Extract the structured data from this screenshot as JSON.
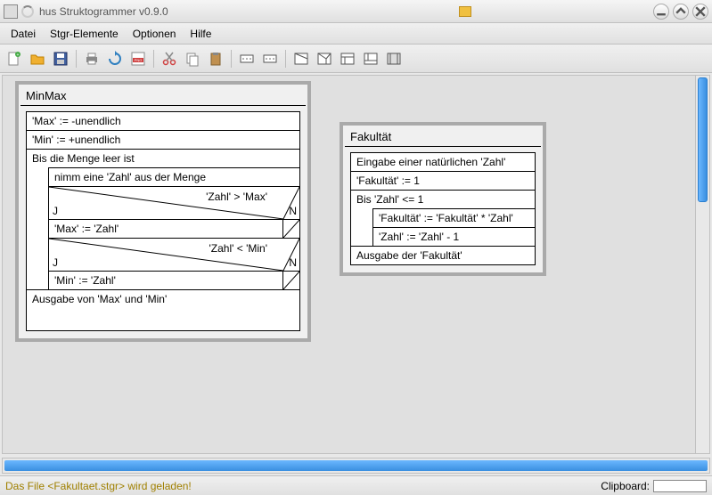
{
  "window": {
    "title": "hus Struktogrammer v0.9.0"
  },
  "menu": {
    "file": "Datei",
    "elements": "Stgr-Elemente",
    "options": "Optionen",
    "help": "Hilfe"
  },
  "struktogram1": {
    "title": "MinMax",
    "init1": "'Max' := -unendlich",
    "init2": "'Min' := +unendlich",
    "loop_head": "Bis die Menge leer ist",
    "pick": "nimm eine 'Zahl' aus der Menge",
    "cond1": "'Zahl' > 'Max'",
    "cond1_j": "J",
    "cond1_n": "N",
    "cond1_true": "'Max' := 'Zahl'",
    "cond2": "'Zahl' < 'Min'",
    "cond2_j": "J",
    "cond2_n": "N",
    "cond2_true": "'Min' := 'Zahl'",
    "output": "Ausgabe von 'Max' und 'Min'"
  },
  "struktogram2": {
    "title": "Fakultät",
    "input": "Eingabe einer natürlichen 'Zahl'",
    "init": "'Fakultät' := 1",
    "loop_head": "Bis 'Zahl' <= 1",
    "body1": "'Fakultät' := 'Fakultät' * 'Zahl'",
    "body2": "'Zahl' := 'Zahl' - 1",
    "output": "Ausgabe der 'Fakultät'"
  },
  "status": {
    "message": "Das File <Fakultaet.stgr> wird geladen!",
    "clipboard_label": "Clipboard:"
  }
}
